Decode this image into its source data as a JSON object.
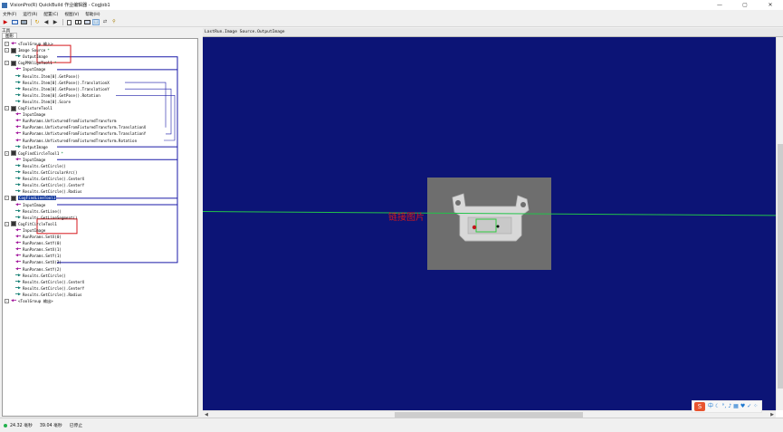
{
  "window": {
    "title": "VisionPro(R) QuickBuild 作业编辑器 - CogJob1",
    "controls": [
      "—",
      "▢",
      "✕"
    ]
  },
  "menu": [
    "文件(F)",
    "运行(R)",
    "配置(C)",
    "视图(V)",
    "帮助(H)"
  ],
  "left_panel": {
    "title": "工具",
    "tab": "图形"
  },
  "tree": {
    "items": [
      {
        "label": "<ToolGroup 输入>",
        "kind": "in",
        "icon": "arrow-left-icon",
        "indent": 0,
        "expander": "-"
      },
      {
        "label": "Image Source",
        "kind": "tool",
        "icon": "image-source-icon",
        "indent": 0,
        "expander": "-",
        "dirty": "*"
      },
      {
        "label": "OutputImage",
        "kind": "out",
        "icon": "arrow-right-icon",
        "indent": 1
      },
      {
        "label": "CogPMAlignTool1",
        "kind": "tool",
        "icon": "pmalign-tool-icon",
        "indent": 0,
        "expander": "-",
        "dirty": "*"
      },
      {
        "label": "InputImage",
        "kind": "in",
        "icon": "arrow-left-icon",
        "indent": 1
      },
      {
        "label": "Results.Item[0].GetPose()",
        "kind": "out",
        "icon": "arrow-right-icon",
        "indent": 1
      },
      {
        "label": "Results.Item[0].GetPose().TranslationX",
        "kind": "out",
        "icon": "arrow-right-icon",
        "indent": 1
      },
      {
        "label": "Results.Item[0].GetPose().TranslationY",
        "kind": "out",
        "icon": "arrow-right-icon",
        "indent": 1
      },
      {
        "label": "Results.Item[0].GetPose().Rotation",
        "kind": "out",
        "icon": "arrow-right-icon",
        "indent": 1
      },
      {
        "label": "Results.Item[0].Score",
        "kind": "out",
        "icon": "arrow-right-icon",
        "indent": 1
      },
      {
        "label": "CogFixtureTool1",
        "kind": "tool",
        "icon": "fixture-tool-icon",
        "indent": 0,
        "expander": "-"
      },
      {
        "label": "InputImage",
        "kind": "in",
        "icon": "arrow-left-icon",
        "indent": 1
      },
      {
        "label": "RunParams.UnfixturedFromFixturedTransform",
        "kind": "in",
        "icon": "arrow-left-icon",
        "indent": 1
      },
      {
        "label": "RunParams.UnfixturedFromFixturedTransform.TranslationX",
        "kind": "in",
        "icon": "arrow-left-icon",
        "indent": 1
      },
      {
        "label": "RunParams.UnfixturedFromFixturedTransform.TranslationY",
        "kind": "in",
        "icon": "arrow-left-icon",
        "indent": 1
      },
      {
        "label": "RunParams.UnfixturedFromFixturedTransform.Rotation",
        "kind": "in",
        "icon": "arrow-left-icon",
        "indent": 1
      },
      {
        "label": "OutputImage",
        "kind": "out",
        "icon": "arrow-right-icon",
        "indent": 1
      },
      {
        "label": "CogFindCircleTool1",
        "kind": "tool",
        "icon": "find-circle-tool-icon",
        "indent": 0,
        "expander": "-",
        "dirty": "*"
      },
      {
        "label": "InputImage",
        "kind": "in",
        "icon": "arrow-left-icon",
        "indent": 1
      },
      {
        "label": "Results.GetCircle()",
        "kind": "out",
        "icon": "arrow-right-icon",
        "indent": 1
      },
      {
        "label": "Results.GetCircularArc()",
        "kind": "out",
        "icon": "arrow-right-icon",
        "indent": 1
      },
      {
        "label": "Results.GetCircle().CenterX",
        "kind": "out",
        "icon": "arrow-right-icon",
        "indent": 1
      },
      {
        "label": "Results.GetCircle().CenterY",
        "kind": "out",
        "icon": "arrow-right-icon",
        "indent": 1
      },
      {
        "label": "Results.GetCircle().Radius",
        "kind": "out",
        "icon": "arrow-right-icon",
        "indent": 1
      },
      {
        "label": "CogFindLineTool1",
        "kind": "tool",
        "icon": "find-line-tool-icon",
        "indent": 0,
        "expander": "-",
        "selected": true
      },
      {
        "label": "InputImage",
        "kind": "in",
        "icon": "arrow-left-icon",
        "indent": 1
      },
      {
        "label": "Results.GetLine()",
        "kind": "out",
        "icon": "arrow-right-icon",
        "indent": 1
      },
      {
        "label": "Results.GetLineSegment()",
        "kind": "out",
        "icon": "arrow-right-icon",
        "indent": 1
      },
      {
        "label": "CogFitCircleTool1",
        "kind": "tool",
        "icon": "fit-circle-tool-icon",
        "indent": 0,
        "expander": "-"
      },
      {
        "label": "InputImage",
        "kind": "in",
        "icon": "arrow-left-icon",
        "indent": 1
      },
      {
        "label": "RunParams.SetX(0)",
        "kind": "in",
        "icon": "arrow-left-icon",
        "indent": 1
      },
      {
        "label": "RunParams.SetY(0)",
        "kind": "in",
        "icon": "arrow-left-icon",
        "indent": 1
      },
      {
        "label": "RunParams.SetX(1)",
        "kind": "in",
        "icon": "arrow-left-icon",
        "indent": 1
      },
      {
        "label": "RunParams.SetY(1)",
        "kind": "in",
        "icon": "arrow-left-icon",
        "indent": 1
      },
      {
        "label": "RunParams.SetX(2)",
        "kind": "in",
        "icon": "arrow-left-icon",
        "indent": 1
      },
      {
        "label": "RunParams.SetY(2)",
        "kind": "in",
        "icon": "arrow-left-icon",
        "indent": 1
      },
      {
        "label": "Results.GetCircle()",
        "kind": "out",
        "icon": "arrow-right-icon",
        "indent": 1
      },
      {
        "label": "Results.GetCircle().CenterX",
        "kind": "out",
        "icon": "arrow-right-icon",
        "indent": 1
      },
      {
        "label": "Results.GetCircle().CenterY",
        "kind": "out",
        "icon": "arrow-right-icon",
        "indent": 1
      },
      {
        "label": "Results.GetCircle().Radius",
        "kind": "out",
        "icon": "arrow-right-icon",
        "indent": 1
      },
      {
        "label": "<ToolGroup 输出>",
        "kind": "in",
        "icon": "arrow-left-icon",
        "indent": 0,
        "expander": "-"
      }
    ]
  },
  "display": {
    "title": "LastRun.Image Source.OutputImage"
  },
  "annotation": "链接图片",
  "status": {
    "time1": "24.32 毫秒",
    "time2": "39.04 毫秒",
    "state": "已停止"
  },
  "ime": {
    "badge": "S",
    "lang": "中"
  },
  "colors": {
    "canvas_bg": "#0c1476",
    "wire": "#1a1aa8",
    "link_out": "#0b7a6e",
    "link_in": "#a0149b",
    "highlight_box": "#d5171c",
    "found_line": "#22c34a"
  }
}
